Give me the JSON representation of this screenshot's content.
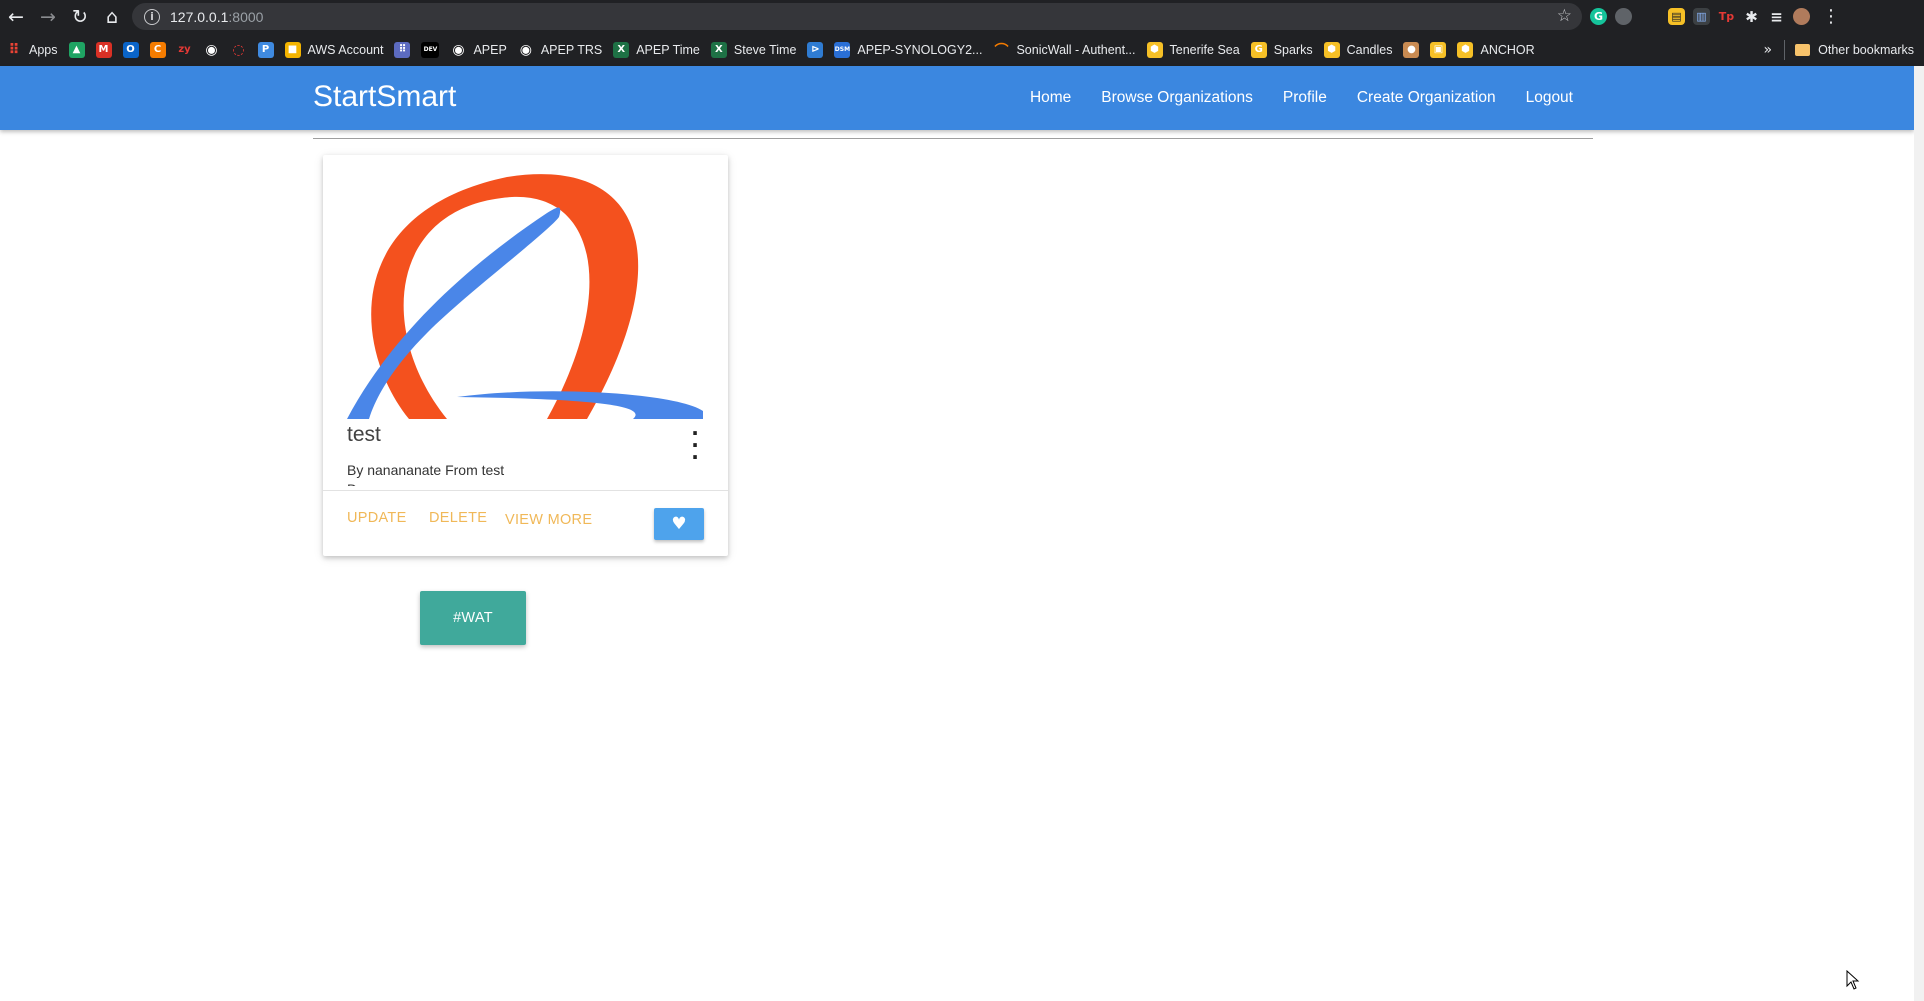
{
  "browser": {
    "url_host": "127.0.0.1",
    "url_port": ":8000",
    "bookmarks": [
      {
        "label": "Apps",
        "icon": "apps-grid-icon",
        "color": "#ea4335"
      },
      {
        "label": "",
        "icon": "google-drive-icon",
        "color": "#1fa463"
      },
      {
        "label": "",
        "icon": "gmail-icon",
        "color": "#d93025"
      },
      {
        "label": "",
        "icon": "outlook-icon",
        "color": "#0a64c8"
      },
      {
        "label": "",
        "icon": "c-icon",
        "color": "#f57c00"
      },
      {
        "label": "",
        "icon": "zy-icon",
        "color": "#e53935"
      },
      {
        "label": "",
        "icon": "globe-icon",
        "color": "#ffffff"
      },
      {
        "label": "",
        "icon": "ring-icon",
        "color": "#e53935"
      },
      {
        "label": "",
        "icon": "p-icon",
        "color": "#3f8ae0"
      },
      {
        "label": "AWS Account",
        "icon": "cube-icon",
        "color": "#f4b400"
      },
      {
        "label": "",
        "icon": "grid-icon",
        "color": "#5c6bc0"
      },
      {
        "label": "",
        "icon": "dev-icon",
        "color": "#000000"
      },
      {
        "label": "APEP",
        "icon": "globe-icon",
        "color": "#ffffff"
      },
      {
        "label": "APEP TRS",
        "icon": "globe-icon",
        "color": "#ffffff"
      },
      {
        "label": "APEP Time",
        "icon": "excel-icon",
        "color": "#1e7145"
      },
      {
        "label": "Steve Time",
        "icon": "excel-icon",
        "color": "#1e7145"
      },
      {
        "label": "",
        "icon": "vscode-icon",
        "color": "#2f7cd3"
      },
      {
        "label": "APEP-SYNOLOGY2...",
        "icon": "dsm-icon",
        "color": "#2a6fd6"
      },
      {
        "label": "SonicWall - Authent...",
        "icon": "sonicwall-icon",
        "color": "#f57c00"
      },
      {
        "label": "Tenerife Sea",
        "icon": "shield-icon",
        "color": "#f6c026"
      },
      {
        "label": "Sparks",
        "icon": "g-icon",
        "color": "#f6c026"
      },
      {
        "label": "Candles",
        "icon": "shield-icon",
        "color": "#f6c026"
      },
      {
        "label": "",
        "icon": "cookie-icon",
        "color": "#c98b52"
      },
      {
        "label": "",
        "icon": "box-icon",
        "color": "#f6c026"
      },
      {
        "label": "ANCHOR",
        "icon": "shield-icon",
        "color": "#f6c026"
      }
    ],
    "other_bookmarks": "Other bookmarks"
  },
  "navbar": {
    "brand": "StartSmart",
    "links": [
      "Home",
      "Browse Organizations",
      "Profile",
      "Create Organization",
      "Logout"
    ],
    "color": "#3b87e0"
  },
  "card": {
    "title": "test",
    "subtitle": "By nanananate From test",
    "cut_text": "D",
    "actions": [
      "UPDATE",
      "DELETE",
      "VIEW MORE"
    ],
    "like_icon": "heart-icon",
    "action_color": "#f0b858",
    "like_color": "#4ea3ec"
  },
  "tag": {
    "label": "#WAT",
    "color": "#40a99b"
  }
}
